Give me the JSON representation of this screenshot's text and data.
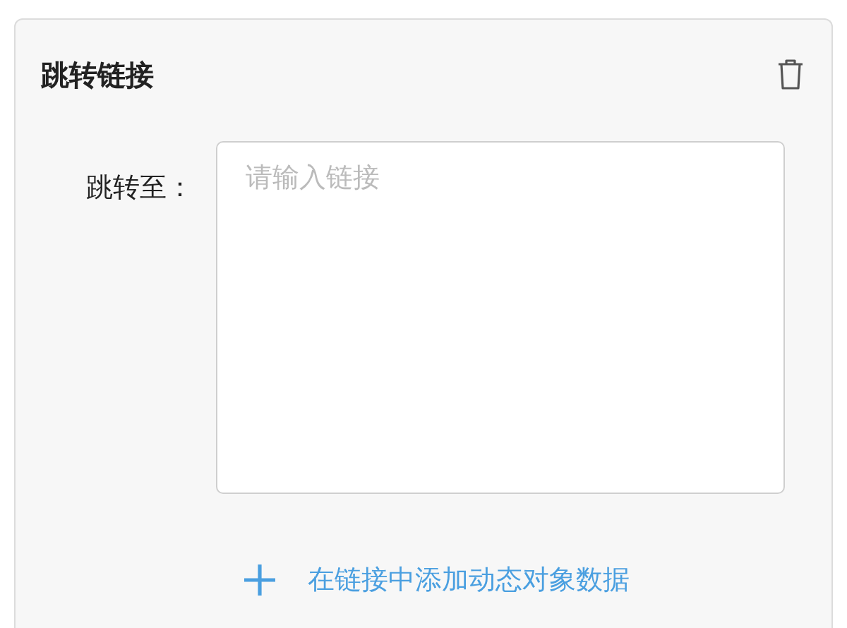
{
  "card": {
    "title": "跳转链接"
  },
  "field": {
    "label": "跳转至：",
    "placeholder": "请输入链接"
  },
  "add_link": {
    "label": "在链接中添加动态对象数据"
  }
}
